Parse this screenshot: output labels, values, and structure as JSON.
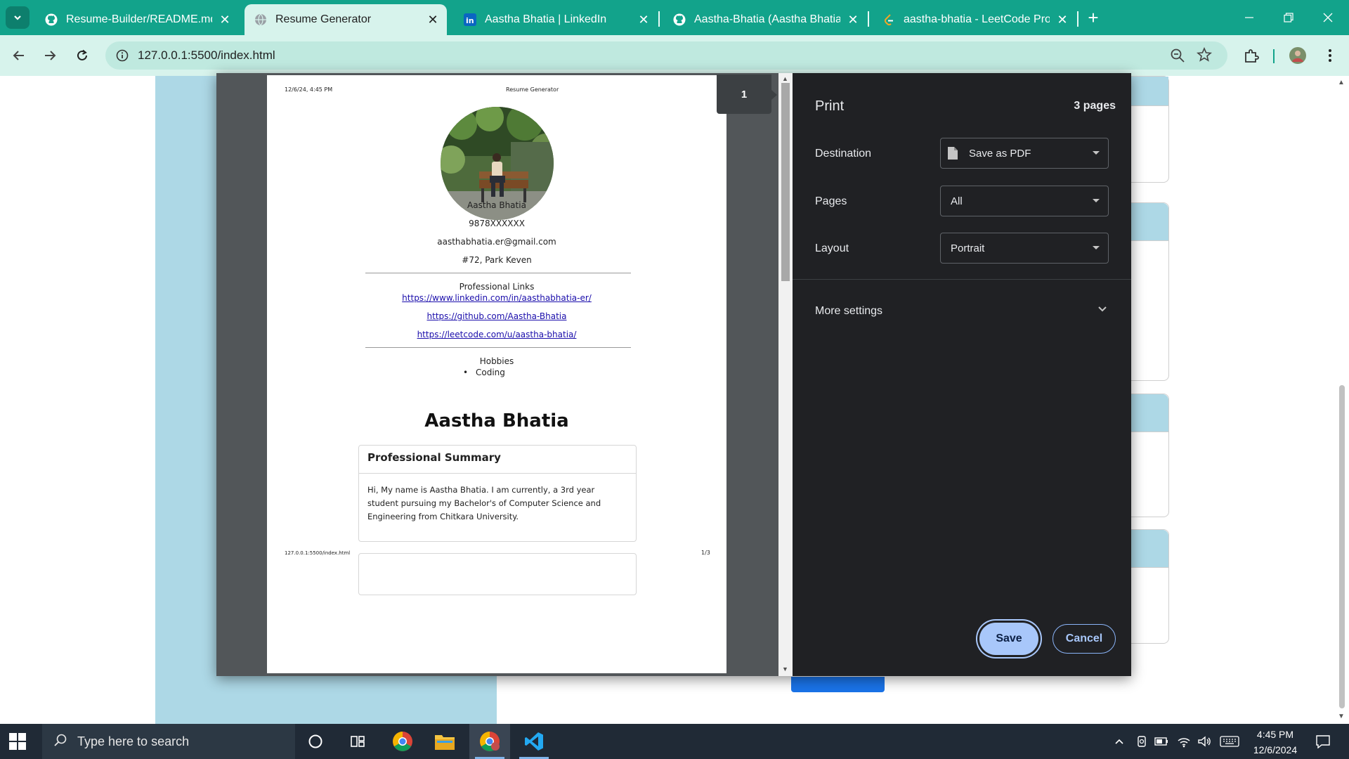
{
  "browser": {
    "tabs": [
      {
        "title": "Resume-Builder/README.md at",
        "active": false,
        "icon": "github-icon"
      },
      {
        "title": "Resume Generator",
        "active": true,
        "icon": "globe-icon"
      },
      {
        "title": "Aastha Bhatia | LinkedIn",
        "active": false,
        "icon": "linkedin-icon"
      },
      {
        "title": "Aastha-Bhatia (Aastha Bhatia)",
        "active": false,
        "icon": "github-icon"
      },
      {
        "title": "aastha-bhatia - LeetCode Profile",
        "active": false,
        "icon": "leetcode-icon"
      }
    ],
    "url": "127.0.0.1:5500/index.html"
  },
  "print_preview": {
    "header_date": "12/6/24, 4:45 PM",
    "header_title": "Resume Generator",
    "footer_url": "127.0.0.1:5500/index.html",
    "footer_page": "1/3",
    "current_page": "1",
    "name": "Aastha Bhatia",
    "phone": "9878XXXXXX",
    "email": "aasthabhatia.er@gmail.com",
    "address": "#72, Park Keven",
    "links_heading": "Professional Links",
    "links": [
      "https://www.linkedin.com/in/aasthabhatia-er/",
      "https://github.com/Aastha-Bhatia",
      "https://leetcode.com/u/aastha-bhatia/"
    ],
    "hobbies_heading": "Hobbies",
    "hobbies": [
      "Coding"
    ],
    "title_name": "Aastha Bhatia",
    "summary_heading": "Professional Summary",
    "summary_text": "Hi, My name is Aastha Bhatia. I am currently, a 3rd year student pursuing my Bachelor's of Computer Science and Engineering from Chitkara University."
  },
  "print_settings": {
    "title": "Print",
    "page_count": "3 pages",
    "destination_label": "Destination",
    "destination_value": "Save as PDF",
    "pages_label": "Pages",
    "pages_value": "All",
    "layout_label": "Layout",
    "layout_value": "Portrait",
    "more_settings": "More settings",
    "save_label": "Save",
    "cancel_label": "Cancel"
  },
  "taskbar": {
    "search_placeholder": "Type here to search",
    "time": "4:45 PM",
    "date": "12/6/2024"
  },
  "colors": {
    "tab_strip": "#12a38b",
    "toolbar": "#d7f3ec",
    "dialog_bg": "#202124",
    "save_button": "#a8c7fa",
    "page_accent": "#add8e6"
  }
}
